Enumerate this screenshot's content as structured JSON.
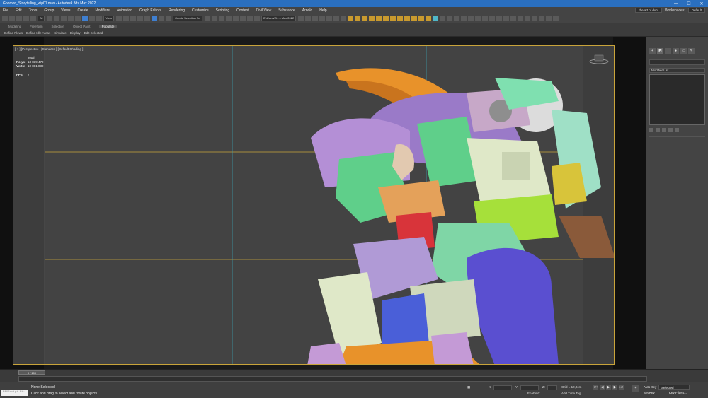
{
  "window": {
    "title": "Gnomon_Storytelling_wip01.max - Autodesk 3ds Max 2022",
    "min": "—",
    "max": "☐",
    "close": "✕"
  },
  "menu": {
    "items": [
      "File",
      "Edit",
      "Tools",
      "Group",
      "Views",
      "Create",
      "Modifiers",
      "Animation",
      "Graph Editors",
      "Rendering",
      "Customize",
      "Scripting",
      "Content",
      "Civil View",
      "Substance",
      "Arnold",
      "Help"
    ],
    "user": "the art of dvht",
    "workspaces_label": "Workspaces:",
    "workspace_value": "Default"
  },
  "toolbar": {
    "filter_value": "All",
    "refcoord_value": "View",
    "selection_set_placeholder": "Create Selection Se",
    "project_path": "C:\\Users\\D...s Max 2022"
  },
  "ribbon": {
    "tabs": [
      "Modeling",
      "Freeform",
      "Selection",
      "Object Paint",
      "Populate"
    ],
    "active_tab": "Populate",
    "sub": [
      "Define Flows",
      "Define Idle Areas",
      "Simulate",
      "Display",
      "Edit Selected"
    ]
  },
  "viewport": {
    "label": "[ + ] [Perspective ] [Standard ] [Default Shading ]",
    "stats_header": "Total",
    "polys_label": "Polys:",
    "polys_value": "13 839 479",
    "verts_label": "Verts:",
    "verts_value": "10 881 839",
    "fps_label": "FPS:",
    "fps_value": "7"
  },
  "command_panel": {
    "modifier_list": "Modifier List"
  },
  "timeline": {
    "slider": "0 / 100"
  },
  "status": {
    "maxscript": "MAXScript Mi:",
    "selection": "None Selected",
    "prompt": "Click and drag to select and rotate objects",
    "x_label": "X:",
    "y_label": "Y:",
    "z_label": "Z:",
    "grid": "Grid = 10,0cm",
    "add_time_tag": "Add Time Tag",
    "enabled": "Enabled:",
    "auto_key": "Auto Key",
    "set_key": "Set Key",
    "selected": "Selected",
    "key_filters": "Key Filters..."
  },
  "colors": {
    "titlebar": "#2a6fbf",
    "viewport_border": "#c9a43a",
    "green": "#5fcf8a",
    "purple": "#9a7ac8",
    "lavender": "#b48fd6",
    "blue": "#5a4fd0",
    "orange": "#e8922a",
    "cream": "#dfe8c8"
  }
}
